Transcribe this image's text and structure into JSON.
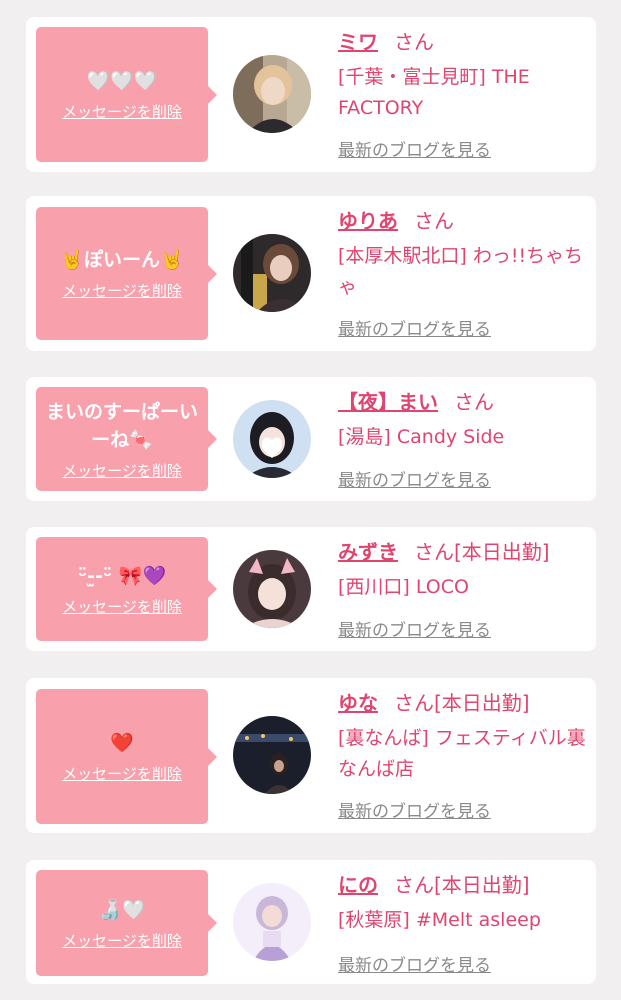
{
  "cards": [
    {
      "message": "🤍🤍🤍",
      "delete_label": "メッセージを削除",
      "name": "ミワ",
      "honorific": "さん",
      "extra": "",
      "shop": "[千葉・富士見町] THE FACTORY",
      "blog_label": "最新のブログを見る"
    },
    {
      "message": "🤘ぽいーん🤘",
      "delete_label": "メッセージを削除",
      "name": "ゆりあ",
      "honorific": "さん",
      "extra": "",
      "shop": "[本厚木駅北口] わっ!!ちゃちゃ",
      "blog_label": "最新のブログを見る"
    },
    {
      "message": "まいのすーぱーいーね🍬",
      "delete_label": "メッセージを削除",
      "name": "【夜】まい",
      "honorific": "さん",
      "extra": "",
      "shop": "[湯島] Candy Side",
      "blog_label": "最新のブログを見る"
    },
    {
      "message": "ᵕ̈-̫-ᵕ̈ 🎀💜",
      "delete_label": "メッセージを削除",
      "name": "みずき",
      "honorific": "さん",
      "extra": "[本日出勤]",
      "shop": "[西川口] LOCO",
      "blog_label": "最新のブログを見る"
    },
    {
      "message": "❤️",
      "delete_label": "メッセージを削除",
      "name": "ゆな",
      "honorific": "さん",
      "extra": "[本日出勤]",
      "shop": "[裏なんば] フェスティバル裏なんば店",
      "blog_label": "最新のブログを見る"
    },
    {
      "message": "🍶🤍",
      "delete_label": "メッセージを削除",
      "name": "にの",
      "honorific": "さん",
      "extra": "[本日出勤]",
      "shop": "[秋葉原] #Melt asleep",
      "blog_label": "最新のブログを見る"
    }
  ]
}
